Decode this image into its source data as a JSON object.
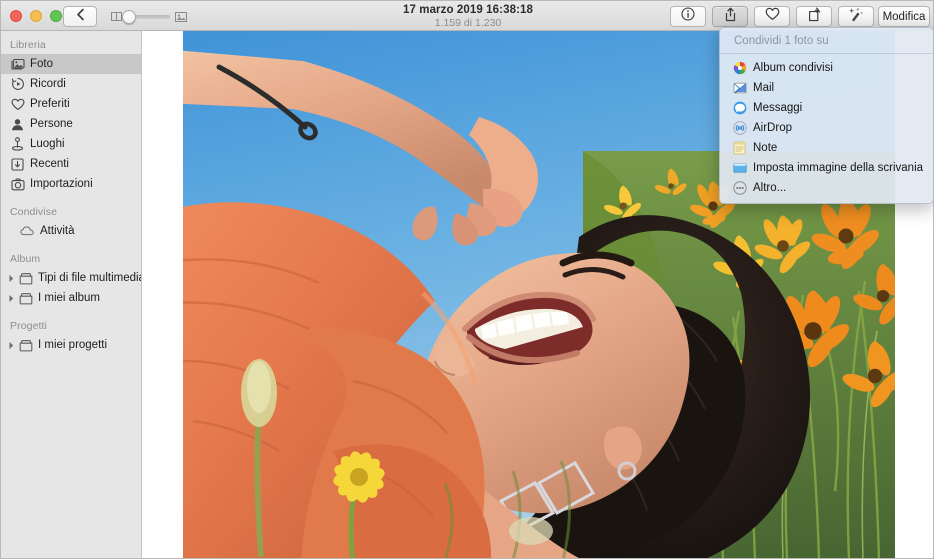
{
  "window": {
    "traffic_lights": [
      {
        "name": "close",
        "color": "#f2655a"
      },
      {
        "name": "minimize",
        "color": "#f6bd4f"
      },
      {
        "name": "zoom",
        "color": "#62c655"
      }
    ]
  },
  "toolbar": {
    "back_icon": "chevron-left-icon",
    "zoom_slider": {
      "min_icon": "grid-view-icon",
      "max_icon": "single-photo-icon",
      "value": 4
    },
    "title": "17 marzo 2019 16:38:18",
    "subtitle": "1.159 di 1.230",
    "buttons": [
      {
        "name": "info-button",
        "icon": "info-circle-icon"
      },
      {
        "name": "share-button",
        "icon": "share-icon",
        "pressed": true
      },
      {
        "name": "favorite-button",
        "icon": "heart-icon"
      },
      {
        "name": "rotate-button",
        "icon": "rotate-icon"
      },
      {
        "name": "enhance-button",
        "icon": "magic-wand-icon"
      }
    ],
    "edit_label": "Modifica"
  },
  "sidebar": {
    "sections": [
      {
        "title": "Libreria",
        "items": [
          {
            "label": "Foto",
            "icon": "photos-icon",
            "selected": true
          },
          {
            "label": "Ricordi",
            "icon": "memories-icon",
            "selected": false
          },
          {
            "label": "Preferiti",
            "icon": "heart-icon",
            "selected": false
          },
          {
            "label": "Persone",
            "icon": "person-icon",
            "selected": false
          },
          {
            "label": "Luoghi",
            "icon": "places-pin-icon",
            "selected": false
          },
          {
            "label": "Recenti",
            "icon": "recents-import-icon",
            "selected": false
          },
          {
            "label": "Importazioni",
            "icon": "imports-camera-icon",
            "selected": false
          }
        ]
      },
      {
        "title": "Condivise",
        "items": [
          {
            "label": "Attività",
            "icon": "cloud-icon",
            "selected": false
          }
        ]
      },
      {
        "title": "Album",
        "items": [
          {
            "label": "Tipi di file multimediali",
            "icon": "folder-icon",
            "selected": false,
            "disclosure": true
          },
          {
            "label": "I miei album",
            "icon": "folder-icon",
            "selected": false,
            "disclosure": true
          }
        ]
      },
      {
        "title": "Progetti",
        "items": [
          {
            "label": "I miei progetti",
            "icon": "folder-icon",
            "selected": false,
            "disclosure": true
          }
        ]
      }
    ]
  },
  "photo": {
    "alt": "Donna sorridente sdraiata in un campo di fiori arancioni sotto un cielo azzurro"
  },
  "share_menu": {
    "header": "Condividi 1 foto su",
    "items": [
      {
        "label": "Album condivisi",
        "icon": "shared-albums-icon"
      },
      {
        "label": "Mail",
        "icon": "mail-icon"
      },
      {
        "label": "Messaggi",
        "icon": "messages-icon"
      },
      {
        "label": "AirDrop",
        "icon": "airdrop-icon"
      },
      {
        "label": "Note",
        "icon": "notes-icon"
      },
      {
        "label": "Imposta immagine della scrivania",
        "icon": "desktop-picture-icon"
      },
      {
        "label": "Altro...",
        "icon": "more-ellipsis-icon"
      }
    ]
  }
}
